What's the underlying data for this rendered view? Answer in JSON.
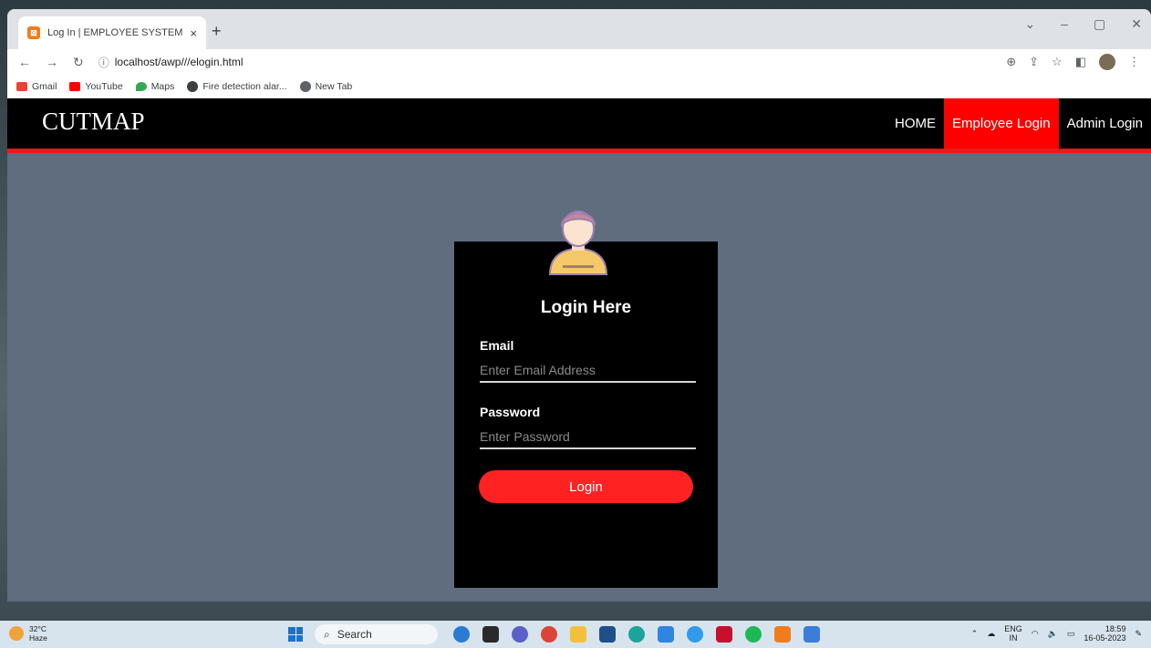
{
  "browser": {
    "tab_title": "Log In | EMPLOYEE SYSTEM",
    "tab_close": "×",
    "new_tab": "+",
    "url": "localhost/awp///elogin.html",
    "bookmarks": [
      {
        "label": "Gmail",
        "color": "#ea4335"
      },
      {
        "label": "YouTube",
        "color": "#ff0000"
      },
      {
        "label": "Maps",
        "color": "#34a853"
      },
      {
        "label": "Fire detection alar...",
        "color": "#3c4043"
      },
      {
        "label": "New Tab",
        "color": "#5f6368"
      }
    ]
  },
  "site": {
    "brand": "CUTMAP",
    "nav": [
      {
        "label": "HOME",
        "active": false
      },
      {
        "label": "Employee Login",
        "active": true
      },
      {
        "label": "Admin Login",
        "active": false
      }
    ],
    "accent_color": "#ff0000"
  },
  "login": {
    "title": "Login Here",
    "email_label": "Email",
    "email_placeholder": "Enter Email Address",
    "password_label": "Password",
    "password_placeholder": "Enter Password",
    "submit_label": "Login"
  },
  "taskbar": {
    "temperature": "32°C",
    "weather": "Haze",
    "search_label": "Search",
    "lang_line1": "ENG",
    "lang_line2": "IN",
    "time": "18:59",
    "date": "16-05-2023"
  }
}
